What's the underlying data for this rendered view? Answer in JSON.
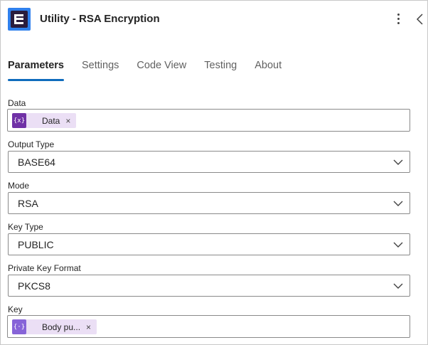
{
  "header": {
    "title": "Utility - RSA Encryption",
    "app_icon": "utility-app-icon",
    "accent": "#2f80ed"
  },
  "tabs": [
    {
      "label": "Parameters",
      "active": true
    },
    {
      "label": "Settings",
      "active": false
    },
    {
      "label": "Code View",
      "active": false
    },
    {
      "label": "Testing",
      "active": false
    },
    {
      "label": "About",
      "active": false
    }
  ],
  "fields": {
    "data": {
      "label": "Data",
      "token_label": "Data",
      "token_icon_text": "{x}",
      "token_color": "#7031a6",
      "remove_glyph": "×"
    },
    "output_type": {
      "label": "Output Type",
      "value": "BASE64"
    },
    "mode": {
      "label": "Mode",
      "value": "RSA"
    },
    "key_type": {
      "label": "Key Type",
      "value": "PUBLIC"
    },
    "private_key_format": {
      "label": "Private Key Format",
      "value": "PKCS8"
    },
    "key": {
      "label": "Key",
      "token_label": "Body pu...",
      "token_icon_text": "{·}",
      "token_color": "#8764d8",
      "remove_glyph": "×"
    }
  },
  "colors": {
    "tab_underline": "#0f6cbd",
    "token_bg": "#ebdff5"
  }
}
